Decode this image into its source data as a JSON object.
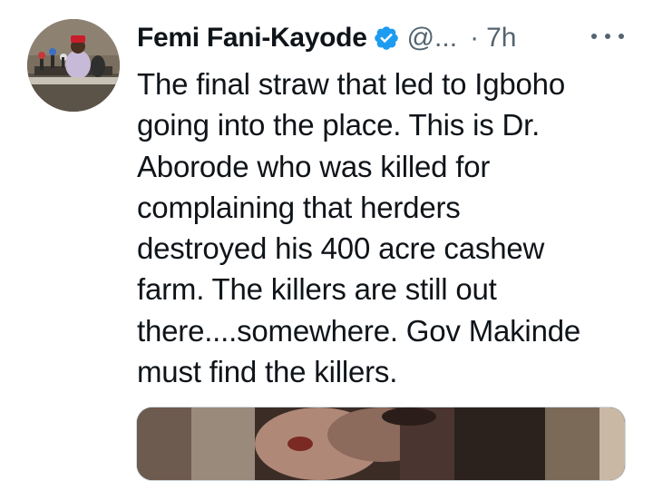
{
  "tweet": {
    "author": {
      "display_name": "Femi Fani-Kayode",
      "handle": "@...",
      "verified_icon": "verified-badge-icon",
      "avatar_icon": "profile-photo"
    },
    "separator": "·",
    "time": "7h",
    "more_icon": "more-options-icon",
    "text_lines": [
      "The final straw that led to Igboho",
      "going into the place. This is Dr.",
      "Aborode who was killed for",
      "complaining that herders",
      "destroyed his 400 acre cashew",
      "farm. The killers are still out",
      "there....somewhere. Gov Makinde",
      "must find the killers."
    ],
    "media": {
      "type": "image"
    }
  },
  "colors": {
    "text": "#0f1419",
    "secondary": "#536471",
    "verified": "#1d9bf0",
    "border": "#cfd9de"
  }
}
